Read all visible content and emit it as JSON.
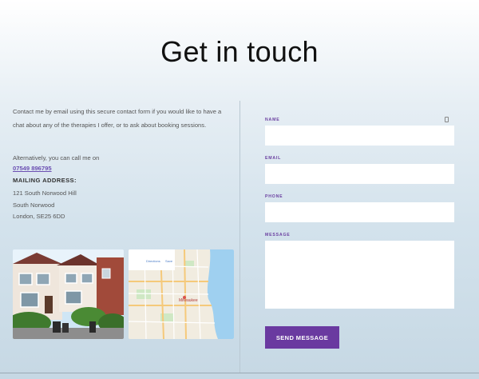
{
  "page": {
    "title": "Get in touch"
  },
  "contact": {
    "intro": "Contact me by email using this secure contact form if you would like to have a chat about any of the therapies I offer, or to ask about booking sessions.",
    "alt_text": "Alternatively, you can call me on",
    "phone": "07549 896795",
    "address_label": "MAILING ADDRESS:",
    "address_lines": [
      "121 South Norwood Hill",
      "South Norwood",
      "London, SE25 6DD"
    ]
  },
  "map": {
    "city_label": "Milwaukee"
  },
  "form": {
    "name_label": "NAME",
    "email_label": "EMAIL",
    "phone_label": "PHONE",
    "message_label": "MESSAGE",
    "submit_label": "SEND MESSAGE"
  },
  "colors": {
    "accent": "#6a3aa0",
    "link": "#6b4fb2"
  }
}
